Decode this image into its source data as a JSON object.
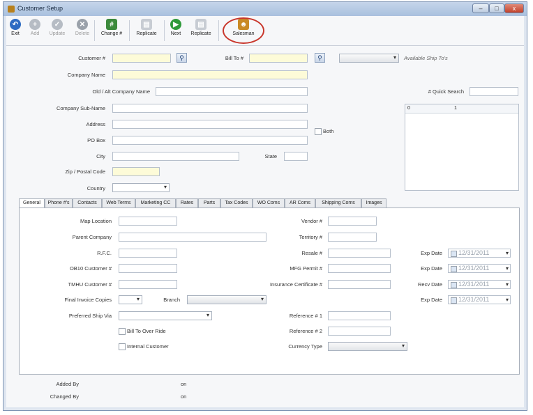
{
  "window": {
    "title": "Customer Setup",
    "buttons": {
      "min": "–",
      "max": "□",
      "close": "x"
    }
  },
  "toolbar": [
    {
      "label": "Exit",
      "icon": "exit-icon",
      "color": "#2e6bc2",
      "disabled": false
    },
    {
      "label": "Add",
      "icon": "add-icon",
      "color": "#b6bcc4",
      "disabled": true
    },
    {
      "label": "Update",
      "icon": "update-icon",
      "color": "#b6bcc4",
      "disabled": true
    },
    {
      "label": "Delete",
      "icon": "delete-icon",
      "color": "#9aa1aa",
      "disabled": true
    },
    {
      "label": "Change #",
      "icon": "change-icon",
      "color": "#3c8a3c",
      "disabled": false
    },
    {
      "label": "Replicate",
      "icon": "replicate-icon",
      "color": "#c7ccd3",
      "disabled": false
    },
    {
      "label": "Next",
      "icon": "next-icon",
      "color": "#2f9a3a",
      "disabled": false
    },
    {
      "label": "Replicate",
      "icon": "replicate-icon",
      "color": "#c7ccd3",
      "disabled": false
    },
    {
      "label": "Salesman",
      "icon": "salesman-icon",
      "color": "#c98a25",
      "disabled": false
    }
  ],
  "form": {
    "customer_label": "Customer #",
    "bill_to_label": "Bill To #",
    "ship_to_hint": "Available Ship To's",
    "company_name_label": "Company Name",
    "old_alt_label": "Old / Alt Company Name",
    "quick_search_label": "# Quick Search",
    "sub_name_label": "Company Sub-Name",
    "address_label": "Address",
    "po_box_label": "PO Box",
    "both_label": "Both",
    "city_label": "City",
    "state_label": "State",
    "zip_label": "Zip / Postal Code",
    "country_label": "Country",
    "list_col1": "0",
    "list_col2": "1"
  },
  "tabs": [
    "General",
    "Phone #'s",
    "Contacts",
    "Web Terms",
    "Marketing CC",
    "Rates",
    "Parts",
    "Tax Codes",
    "WO Coms",
    "AR Coms",
    "Shipping Coms",
    "Images"
  ],
  "general": {
    "map_location": "Map Location",
    "parent_company": "Parent Company",
    "rfc": "R.F.C.",
    "ob10": "OB10 Customer #",
    "tmhu": "TMHU Customer #",
    "final_invoice": "Final Invoice Copies",
    "branch": "Branch",
    "preferred_ship": "Preferred Ship Via",
    "bill_to_override": "Bill To Over Ride",
    "internal_customer": "Internal Customer",
    "vendor": "Vendor #",
    "territory": "Territory #",
    "resale": "Resale #",
    "mfg_permit": "MFG Permit #",
    "insurance": "Insurance Certificate #",
    "reference1": "Reference # 1",
    "reference2": "Reference # 2",
    "currency": "Currency Type",
    "exp_date": "Exp Date",
    "recv_date": "Recv Date",
    "date1": "12/31/2011",
    "date2": "12/31/2011",
    "date3": "12/31/2011",
    "date4": "12/31/2011"
  },
  "footer": {
    "added_by": "Added By",
    "changed_by": "Changed By",
    "added_on": "on",
    "changed_on": "on"
  }
}
